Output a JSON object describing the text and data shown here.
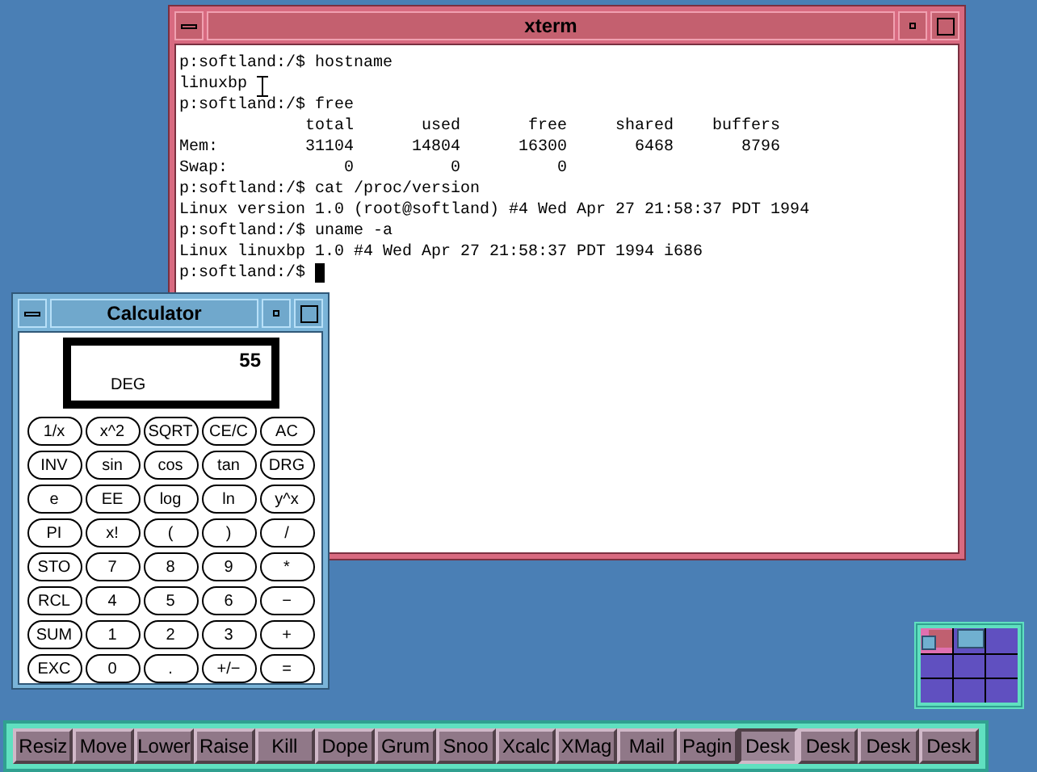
{
  "windows": [
    {
      "kind": "terminal",
      "title": "xterm",
      "lines": [
        "p:softland:/$ hostname",
        "linuxbp",
        "p:softland:/$ free",
        "             total       used       free     shared    buffers",
        "Mem:         31104      14804      16300       6468       8796",
        "Swap:            0          0          0",
        "p:softland:/$ cat /proc/version",
        "Linux version 1.0 (root@softland) #4 Wed Apr 27 21:58:37 PDT 1994",
        "p:softland:/$ uname -a",
        "Linux linuxbp 1.0 #4 Wed Apr 27 21:58:37 PDT 1994 i686",
        "p:softland:/$ "
      ]
    },
    {
      "kind": "calculator",
      "title": "Calculator",
      "display": {
        "value": "55",
        "mode": "DEG"
      },
      "keys": [
        "1/x",
        "x^2",
        "SQRT",
        "CE/C",
        "AC",
        "INV",
        "sin",
        "cos",
        "tan",
        "DRG",
        "e",
        "EE",
        "log",
        "ln",
        "y^x",
        "PI",
        "x!",
        "(",
        ")",
        "/",
        "STO",
        "7",
        "8",
        "9",
        "*",
        "RCL",
        "4",
        "5",
        "6",
        "−",
        "SUM",
        "1",
        "2",
        "3",
        "+",
        "EXC",
        "0",
        ".",
        "+/−",
        "="
      ]
    }
  ],
  "button_bar": {
    "buttons": [
      {
        "label": "Resiz",
        "selected": false
      },
      {
        "label": "Move",
        "selected": false
      },
      {
        "label": "Lower",
        "selected": false
      },
      {
        "label": "Raise",
        "selected": false
      },
      {
        "label": "Kill",
        "selected": false
      },
      {
        "label": "Dope",
        "selected": false
      },
      {
        "label": "Grum",
        "selected": false
      },
      {
        "label": "Snoo",
        "selected": false
      },
      {
        "label": "Xcalc",
        "selected": false
      },
      {
        "label": "XMag",
        "selected": false
      },
      {
        "label": "Mail",
        "selected": false
      },
      {
        "label": "Pagin",
        "selected": false
      },
      {
        "label": "Desk",
        "selected": true
      },
      {
        "label": "Desk",
        "selected": false
      },
      {
        "label": "Desk",
        "selected": false
      },
      {
        "label": "Desk",
        "selected": false
      }
    ]
  }
}
